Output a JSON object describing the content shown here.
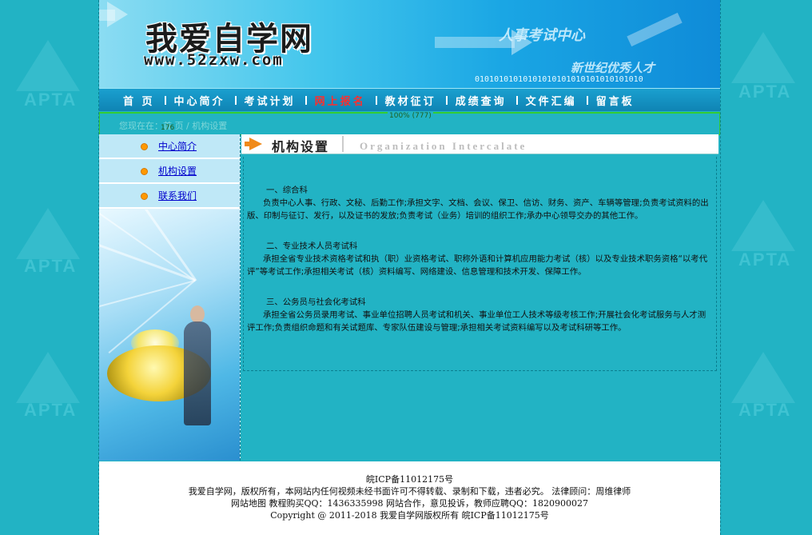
{
  "header": {
    "site_title": "我爱自学网",
    "site_url": "www.52zxw.com",
    "slogan_line1": "人事考试中心",
    "slogan_line2": "新世纪优秀人才",
    "binary": "01010101010101010101010101010101010"
  },
  "background": {
    "watermark": "APTA"
  },
  "nav": {
    "items": [
      {
        "label": "首 页",
        "active": false
      },
      {
        "label": "中心简介",
        "active": false
      },
      {
        "label": "考试计划",
        "active": false
      },
      {
        "label": "网上报名",
        "active": true
      },
      {
        "label": "教材征订",
        "active": false
      },
      {
        "label": "成绩查询",
        "active": false
      },
      {
        "label": "文件汇编",
        "active": false
      },
      {
        "label": "留言板",
        "active": false
      }
    ]
  },
  "breadcrumb": {
    "text": "您现在在：首 页 / 机构设置",
    "ruler_label": "100% (777)",
    "ruler_sidebar": "176"
  },
  "sidebar": {
    "items": [
      {
        "label": "中心简介"
      },
      {
        "label": "机构设置"
      },
      {
        "label": "联系我们"
      }
    ]
  },
  "content": {
    "title": "机构设置",
    "title_en": "Organization Intercalate",
    "sections": [
      {
        "title": "一、综合科",
        "text": "负责中心人事、行政、文秘、后勤工作;承担文字、文档、会议、保卫、信访、财务、资产、车辆等管理;负责考试资料的出版、印制与征订、发行，以及证书的发放;负责考试（业务）培训的组织工作;承办中心领导交办的其他工作。"
      },
      {
        "title": "二、专业技术人员考试科",
        "text": "承担全省专业技术资格考试和执（职）业资格考试、职称外语和计算机应用能力考试（核）以及专业技术职务资格“以考代评”等考试工作;承担相关考试（核）资料编写、网络建设、信息管理和技术开发、保障工作。"
      },
      {
        "title": "三、公务员与社会化考试科",
        "text": "承担全省公务员录用考试、事业单位招聘人员考试和机关、事业单位工人技术等级考核工作;开展社会化考试服务与人才测评工作;负责组织命题和有关试题库、专家队伍建设与管理;承担相关考试资料编写以及考试科研等工作。"
      }
    ]
  },
  "footer": {
    "line1": "皖ICP备11012175号",
    "line2": "我爱自学网，版权所有，本网站内任何视频未经书面许可不得转载、录制和下载，违者必究。 法律顾问：周维律师",
    "line3": "网站地图 教程购买QQ：1436335998 网站合作，意见投诉，教师应聘QQ：1820900027",
    "line4": "Copyright @ 2011-2018 我爱自学网版权所有 皖ICP备11012175号"
  }
}
